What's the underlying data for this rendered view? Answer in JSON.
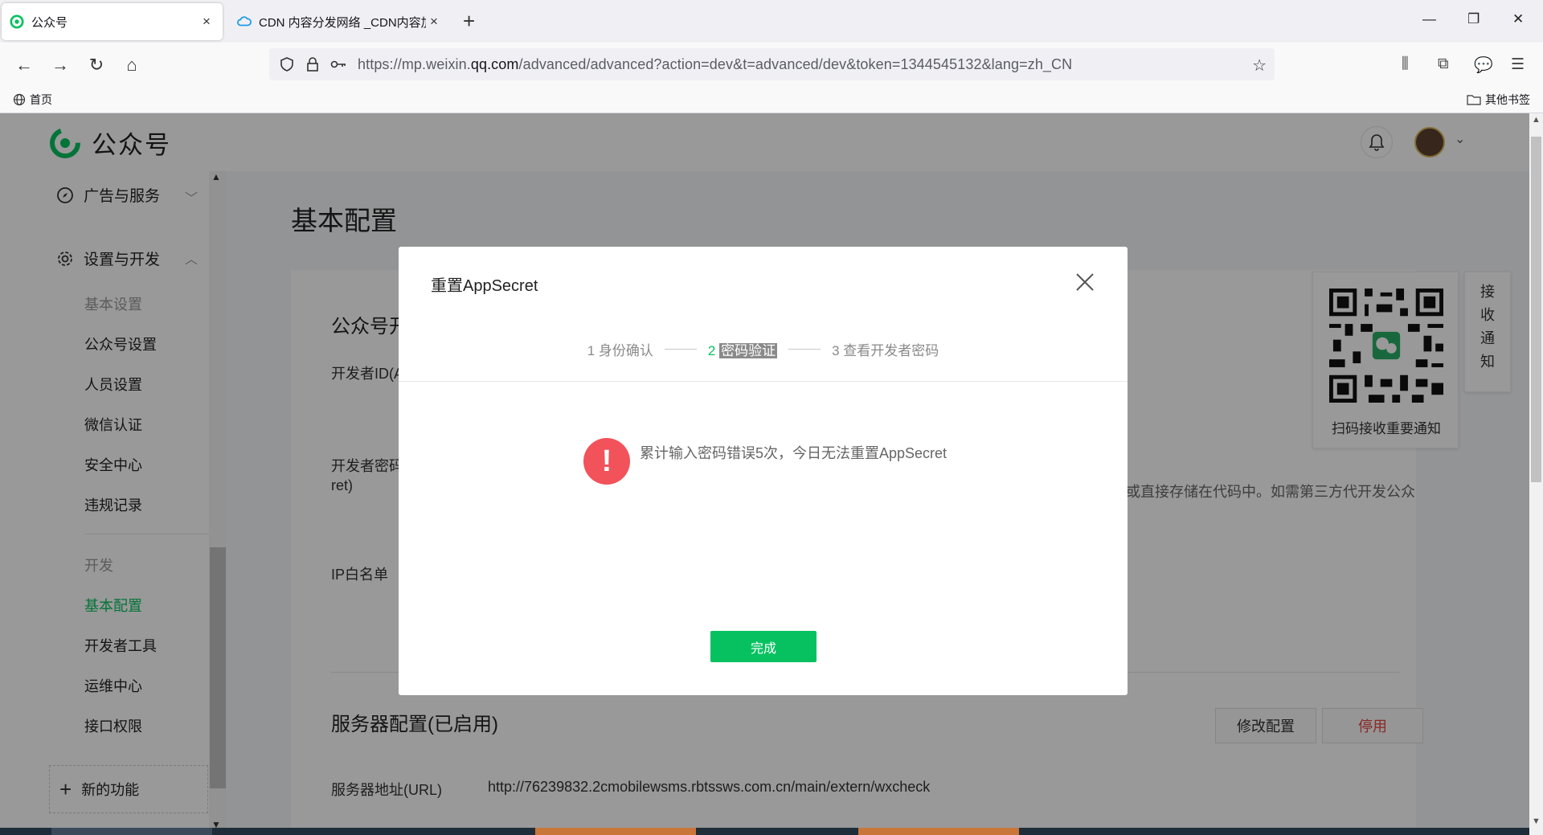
{
  "browser": {
    "tabs": [
      {
        "title": "公众号",
        "close": "×"
      },
      {
        "title": "CDN 内容分发网络 _CDN内容加",
        "close": "×"
      }
    ],
    "new_tab": "+",
    "window_controls": {
      "minimize": "—",
      "restore": "❐",
      "close": "✕"
    },
    "url": {
      "prefix": "https://mp.weixin.",
      "domain": "qq.com",
      "path": "/advanced/advanced?action=dev&t=advanced/dev&token=1344545132&lang=zh_CN"
    },
    "bookmarks": {
      "home": "首页",
      "other": "其他书签"
    }
  },
  "app": {
    "brand": "公众号",
    "sidebar": {
      "group_ads": "广告与服务",
      "group_settings": "设置与开发",
      "basic_settings_header": "基本设置",
      "items_basic": [
        "公众号设置",
        "人员设置",
        "微信认证",
        "安全中心",
        "违规记录"
      ],
      "dev_header": "开发",
      "items_dev": [
        "基本配置",
        "开发者工具",
        "运维中心",
        "接口权限"
      ],
      "active_item": "基本配置",
      "new_feature": "新的功能"
    },
    "main": {
      "title": "基本配置",
      "section1_title": "公众号开",
      "dev_id_label": "开发者ID(A",
      "dev_pwd_label_1": "开发者密码",
      "dev_pwd_label_2": "ret)",
      "ip_label": "IP白名单",
      "pwd_desc": "或直接存储在代码中。如需第三方代开发公众",
      "section2_title": "服务器配置(已启用)",
      "modify_button": "修改配置",
      "disable_button": "停用",
      "server_url_label": "服务器地址(URL)",
      "server_url_value": "http://76239832.2cmobilewsms.rbtssws.com.cn/main/extern/wxcheck"
    },
    "qr": {
      "caption": "扫码接收重要通知"
    },
    "notice_tab": [
      "接",
      "收",
      "通",
      "知"
    ]
  },
  "modal": {
    "title": "重置AppSecret",
    "steps": [
      {
        "num": "1",
        "label": "身份确认"
      },
      {
        "num": "2",
        "label": "密码验证"
      },
      {
        "num": "3",
        "label": "查看开发者密码"
      }
    ],
    "current_step": 2,
    "message": "累计输入密码错误5次，今日无法重置AppSecret",
    "warn_symbol": "!",
    "done_button": "完成"
  },
  "colors": {
    "accent": "#07c160",
    "danger": "#f2525a",
    "disable_text": "#e64340"
  }
}
